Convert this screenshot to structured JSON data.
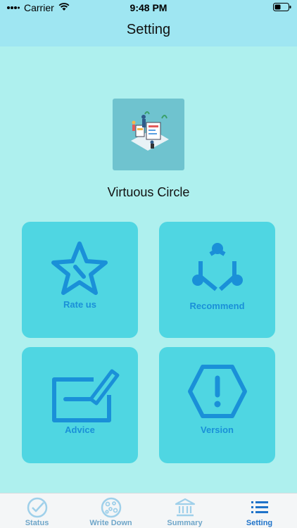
{
  "status_bar": {
    "carrier": "Carrier",
    "time": "9:48 PM",
    "wifi_icon": "wifi-icon",
    "battery_icon": "battery-icon"
  },
  "nav": {
    "title": "Setting"
  },
  "app": {
    "name": "Virtuous Circle",
    "logo_icon": "app-illustration"
  },
  "tiles": [
    {
      "label": "Rate us",
      "icon": "star-icon"
    },
    {
      "label": "Recommend",
      "icon": "share-icon"
    },
    {
      "label": "Advice",
      "icon": "edit-icon"
    },
    {
      "label": "Version",
      "icon": "warning-icon"
    }
  ],
  "tabs": [
    {
      "label": "Status",
      "icon": "check-circle-icon",
      "active": false
    },
    {
      "label": "Write Down",
      "icon": "cookie-icon",
      "active": false
    },
    {
      "label": "Summary",
      "icon": "bank-icon",
      "active": false
    },
    {
      "label": "Setting",
      "icon": "list-icon",
      "active": true
    }
  ],
  "colors": {
    "background": "#aef0ee",
    "header": "#9fe6f2",
    "tile": "#4fd6e2",
    "tile_icon": "#1a90d8",
    "tab_active": "#1f73c9",
    "tab_inactive": "#6fa6c9"
  }
}
